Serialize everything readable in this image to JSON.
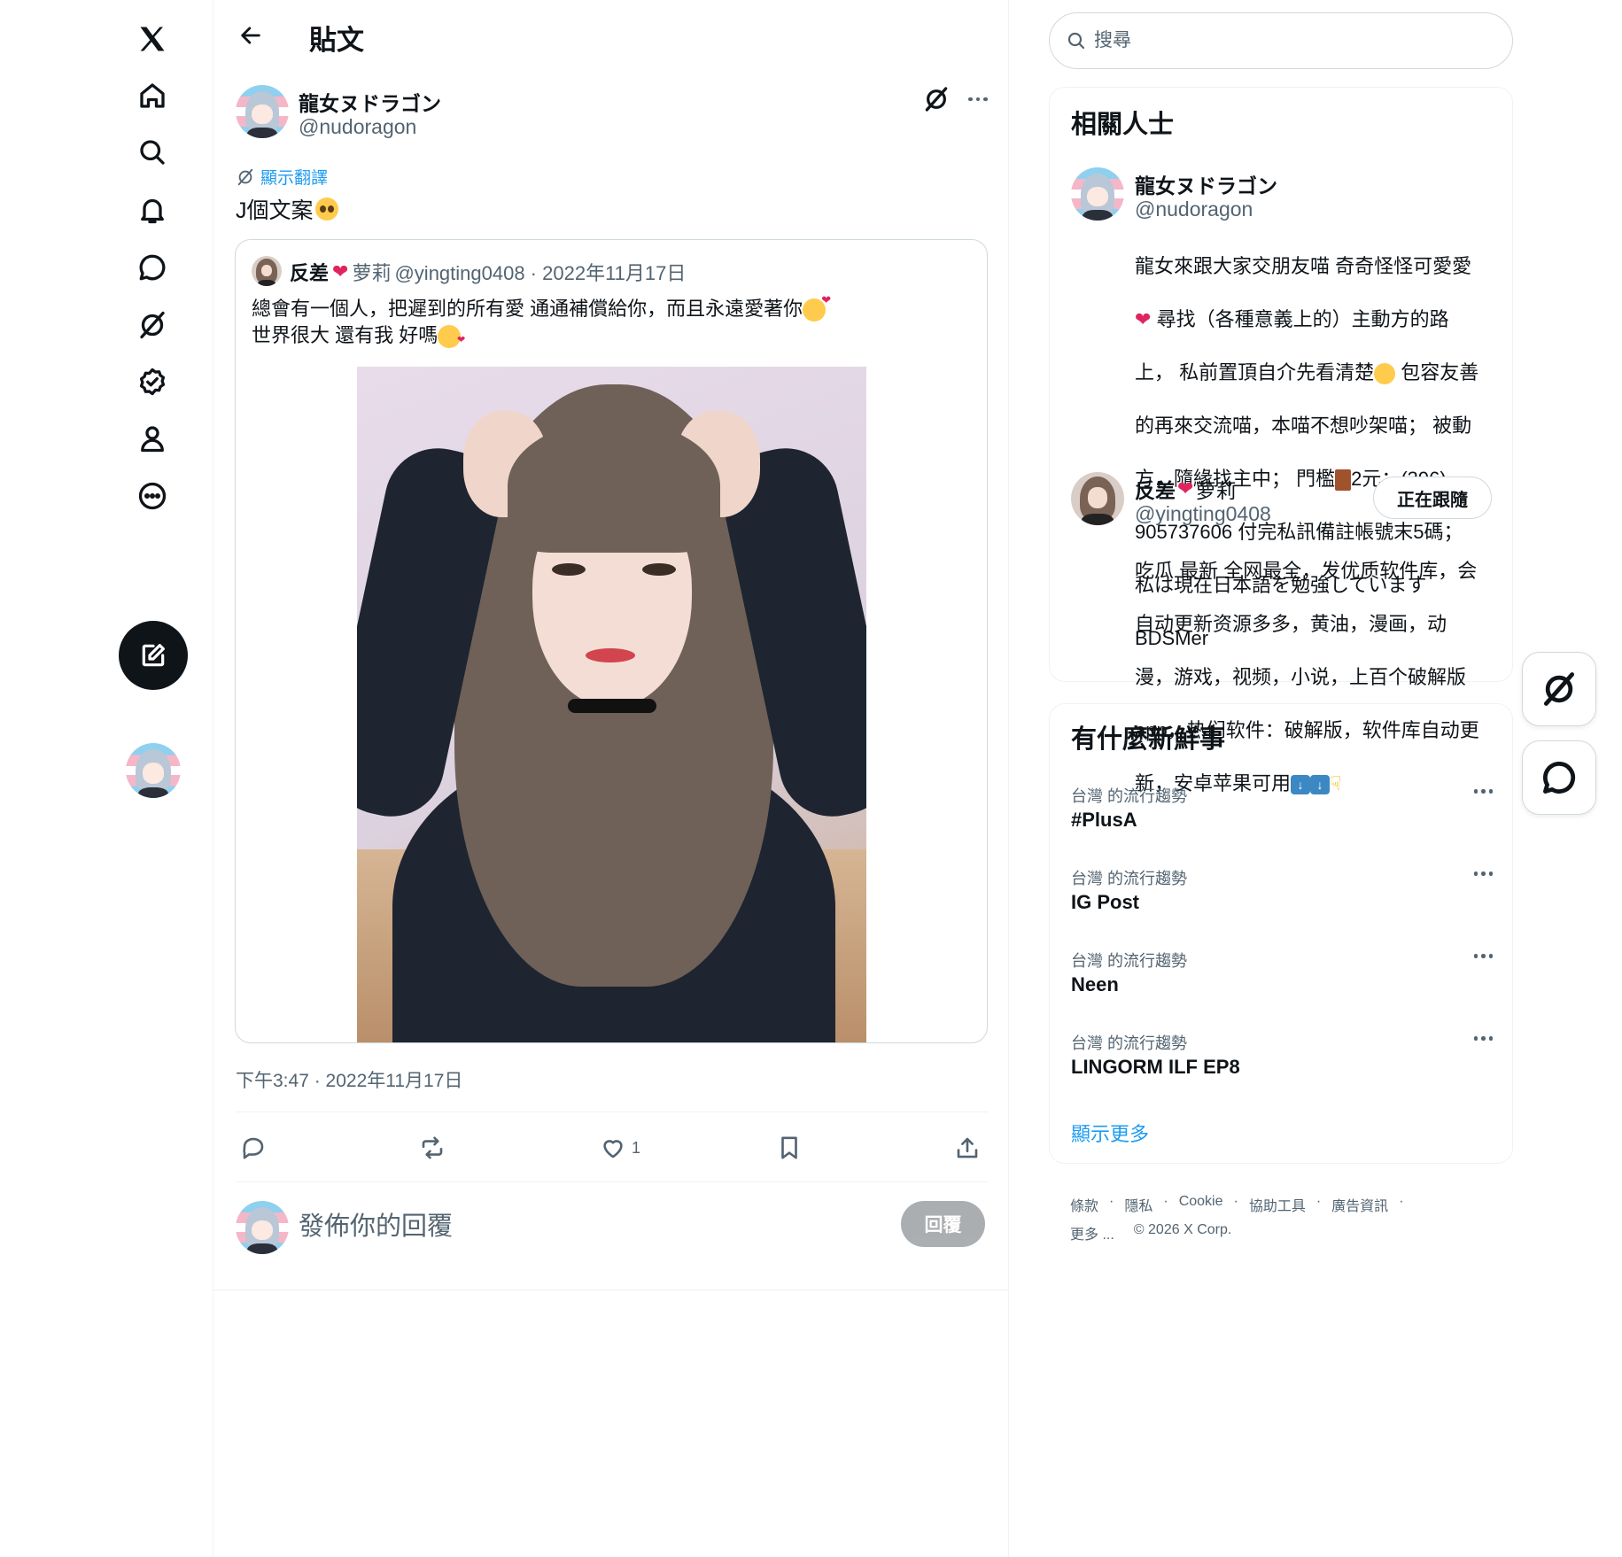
{
  "header": {
    "title": "貼文"
  },
  "post": {
    "author_name": "龍女ヌドラゴン",
    "author_handle": "@nudoragon",
    "translate_label": "顯示翻譯",
    "text": "J個文案",
    "timestamp": "下午3:47 · 2022年11月17日",
    "like_count": "1"
  },
  "quote": {
    "name_part1": "反差",
    "name_part2": "萝莉",
    "meta": "@yingting0408 · 2022年11月17日",
    "line1": "總會有一個人，把遲到的所有愛 通通補償給你，而且永遠愛著你",
    "line2": "世界很大 還有我 好嗎"
  },
  "reply": {
    "placeholder": "發佈你的回覆",
    "button": "回覆"
  },
  "search": {
    "placeholder": "搜尋"
  },
  "related": {
    "title": "相關人士",
    "people": [
      {
        "name": "龍女ヌドラゴン",
        "handle": "@nudoragon",
        "bio_line1": "龍女來跟大家交朋友喵 奇奇怪怪可愛愛",
        "bio_line2": "尋找（各種意義上的）主動方的路",
        "bio_line3": "上， 私前置頂自介先看清楚",
        "bio_line3b": "包容友善",
        "bio_line4": "的再來交流喵，本喵不想吵架喵； 被動",
        "bio_line5": "方，隨緣找主中； 門檻",
        "bio_line5b": "2元：(396)",
        "bio_line6": "905737606 付完私訊備註帳號末5碼；",
        "bio_line7": "私は現在日本語を勉強しています",
        "bio_line8": "BDSMer"
      },
      {
        "name_part1": "反差",
        "name_part2": "萝莉",
        "handle": "@yingting0408",
        "follow_label": "正在跟隨",
        "bio_line1": "吃瓜 最新 全网最全，发优质软件库，会",
        "bio_line2": "自动更新资源多多，黄油，漫画，动",
        "bio_line3": "漫，游戏，视频，小说，上百个破解版",
        "bio_line4": "app，热们软件：破解版，软件库自动更",
        "bio_line5": "新，安卓苹果可用"
      }
    ]
  },
  "trends": {
    "title": "有什麼新鮮事",
    "items": [
      {
        "context": "台灣 的流行趨勢",
        "name": "#PlusA"
      },
      {
        "context": "台灣 的流行趨勢",
        "name": "IG Post"
      },
      {
        "context": "台灣 的流行趨勢",
        "name": "Neen"
      },
      {
        "context": "台灣 的流行趨勢",
        "name": "LINGORM ILF EP8"
      }
    ],
    "show_more": "顯示更多"
  },
  "footer": {
    "links": [
      "條款",
      "隱私",
      "Cookie",
      "協助工具",
      "廣告資訊"
    ],
    "more": "更多 ...",
    "copyright": "© 2026 X Corp."
  },
  "icons": {
    "nav": [
      "x-logo-icon",
      "home-icon",
      "search-icon",
      "bell-icon",
      "message-icon",
      "grok-icon",
      "verified-icon",
      "profile-icon",
      "more-circle-icon"
    ],
    "compose": "compose-icon"
  },
  "colors": {
    "accent": "#1d9bf0",
    "text": "#0f1419",
    "secondary": "#536471",
    "heart": "#e0245e"
  }
}
